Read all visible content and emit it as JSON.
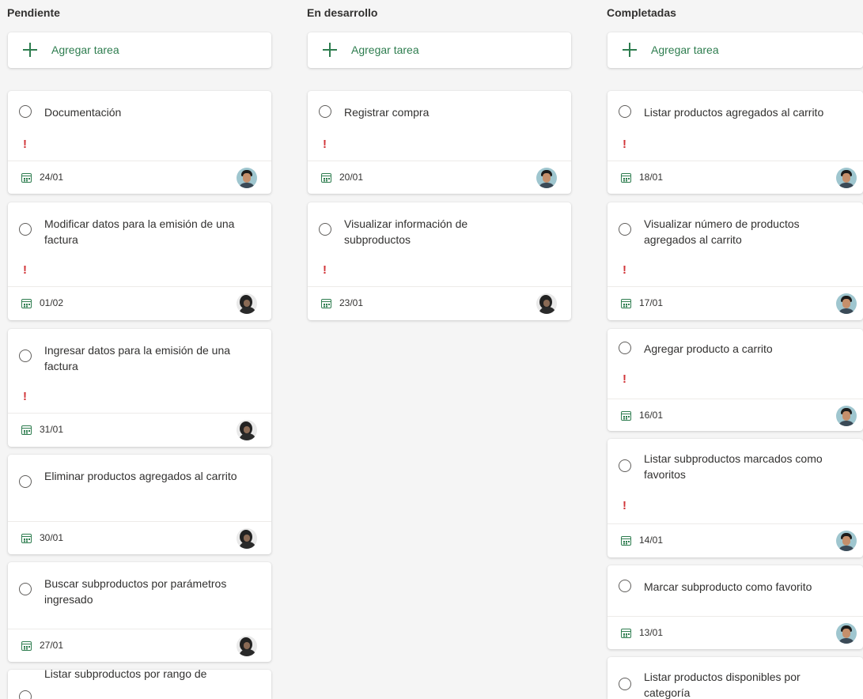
{
  "columns": [
    {
      "title": "Pendiente",
      "add_label": "Agregar tarea",
      "cards": [
        {
          "title": "Documentación",
          "important": true,
          "date": "24/01",
          "avatar": "a"
        },
        {
          "title": "Modificar datos para la emisión de una factura",
          "important": true,
          "date": "01/02",
          "avatar": "b"
        },
        {
          "title": "Ingresar datos para la emisión de una factura",
          "important": true,
          "date": "31/01",
          "avatar": "b"
        },
        {
          "title": "Eliminar productos agregados al carrito",
          "important": false,
          "date": "30/01",
          "avatar": "b"
        },
        {
          "title": "Buscar subproductos por parámetros ingresado",
          "important": false,
          "date": "27/01",
          "avatar": "b"
        },
        {
          "title": "Listar subproductos por rango de",
          "important": false,
          "date": "",
          "avatar": ""
        }
      ]
    },
    {
      "title": "En desarrollo",
      "add_label": "Agregar tarea",
      "cards": [
        {
          "title": "Registrar compra",
          "important": true,
          "date": "20/01",
          "avatar": "a"
        },
        {
          "title": "Visualizar información de subproductos",
          "important": true,
          "date": "23/01",
          "avatar": "b"
        }
      ]
    },
    {
      "title": "Completadas",
      "add_label": "Agregar tarea",
      "cards": [
        {
          "title": "Listar productos agregados al carrito",
          "important": true,
          "date": "18/01",
          "avatar": "a"
        },
        {
          "title": "Visualizar número de productos agregados al carrito",
          "important": true,
          "date": "17/01",
          "avatar": "a"
        },
        {
          "title": "Agregar producto a carrito",
          "important": true,
          "date": "16/01",
          "avatar": "a"
        },
        {
          "title": "Listar subproductos marcados como favoritos",
          "important": true,
          "date": "14/01",
          "avatar": "a"
        },
        {
          "title": "Marcar subproducto como favorito",
          "important": false,
          "date": "13/01",
          "avatar": "a"
        },
        {
          "title": "Listar productos disponibles por categoría",
          "important": false,
          "date": "",
          "avatar": ""
        }
      ]
    }
  ],
  "icons": {
    "add": "plus-icon",
    "checkbox": "circle-checkbox-icon",
    "priority": "exclamation-icon",
    "due_date": "calendar-icon",
    "assignee": "avatar"
  },
  "colors": {
    "accent": "#2e7d4f",
    "priority": "#d13438",
    "background": "#f5f5f5",
    "card": "#ffffff"
  }
}
